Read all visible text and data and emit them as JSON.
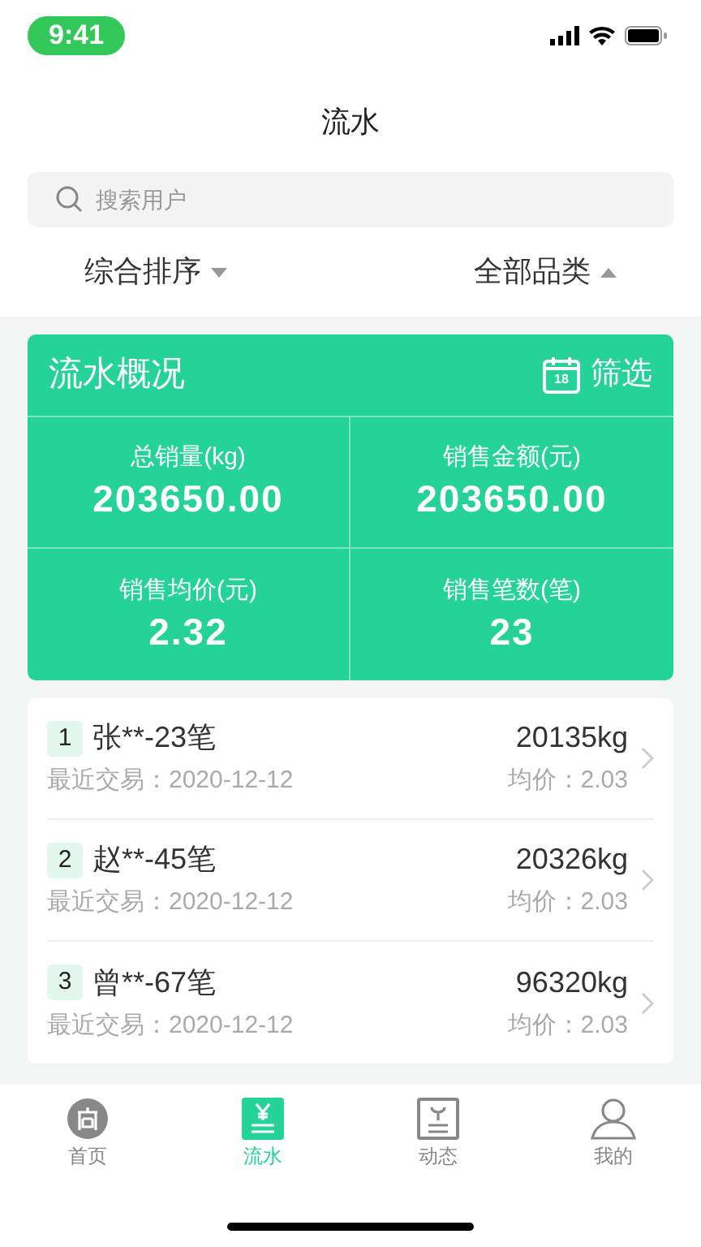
{
  "status_bar": {
    "time": "9:41"
  },
  "title": "流水",
  "search": {
    "placeholder": "搜索用户"
  },
  "filters": [
    {
      "label": "综合排序",
      "expanded": false
    },
    {
      "label": "全部品类",
      "expanded": true
    }
  ],
  "summary": {
    "title": "流水概况",
    "filter_label": "筛选",
    "calendar_day": "18",
    "stats": [
      {
        "label": "总销量(kg)",
        "value": "203650.00"
      },
      {
        "label": "销售金额(元)",
        "value": "203650.00"
      },
      {
        "label": "销售均价(元)",
        "value": "2.32"
      },
      {
        "label": "销售笔数(笔)",
        "value": "23"
      }
    ]
  },
  "records": [
    {
      "rank": "1",
      "name": "张**-23笔",
      "date": "最近交易：2020-12-12",
      "weight": "20135kg",
      "price": "均价：2.03"
    },
    {
      "rank": "2",
      "name": "赵**-45笔",
      "date": "最近交易：2020-12-12",
      "weight": "20326kg",
      "price": "均价：2.03"
    },
    {
      "rank": "3",
      "name": "曾**-67笔",
      "date": "最近交易：2020-12-12",
      "weight": "96320kg",
      "price": "均价：2.03"
    }
  ],
  "tab_bar": [
    {
      "label": "首页",
      "kind": "shop",
      "selected": false
    },
    {
      "label": "流水",
      "kind": "money",
      "selected": true
    },
    {
      "label": "动态",
      "kind": "news",
      "selected": false
    },
    {
      "label": "我的",
      "kind": "user",
      "selected": false
    }
  ]
}
